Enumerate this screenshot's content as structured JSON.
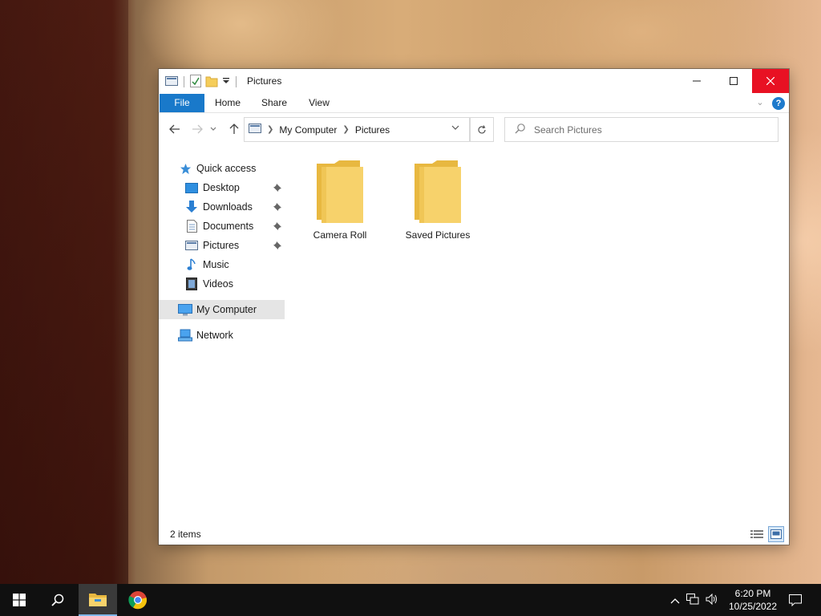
{
  "window": {
    "title": "Pictures",
    "ribbon_tabs": [
      "File",
      "Home",
      "Share",
      "View"
    ],
    "address": {
      "crumbs": [
        "My Computer",
        "Pictures"
      ]
    },
    "search_placeholder": "Search Pictures"
  },
  "nav_pane": {
    "quick_access": "Quick access",
    "items": [
      {
        "label": "Desktop",
        "icon": "desktop-icon",
        "pinned": true
      },
      {
        "label": "Downloads",
        "icon": "download-arrow-icon",
        "pinned": true
      },
      {
        "label": "Documents",
        "icon": "document-icon",
        "pinned": true
      },
      {
        "label": "Pictures",
        "icon": "pictures-icon",
        "pinned": true
      },
      {
        "label": "Music",
        "icon": "music-note-icon",
        "pinned": false
      },
      {
        "label": "Videos",
        "icon": "film-icon",
        "pinned": false
      }
    ],
    "this_pc": "My Computer",
    "network": "Network"
  },
  "content": {
    "folders": [
      {
        "name": "Camera Roll"
      },
      {
        "name": "Saved Pictures"
      }
    ]
  },
  "status": {
    "count": "2 items"
  },
  "taskbar": {
    "time": "6:20 PM",
    "date": "10/25/2022"
  },
  "colors": {
    "accent": "#1979ca",
    "close_red": "#e81123",
    "folder_yellow": "#f5cd5a",
    "taskbar": "#101010"
  }
}
